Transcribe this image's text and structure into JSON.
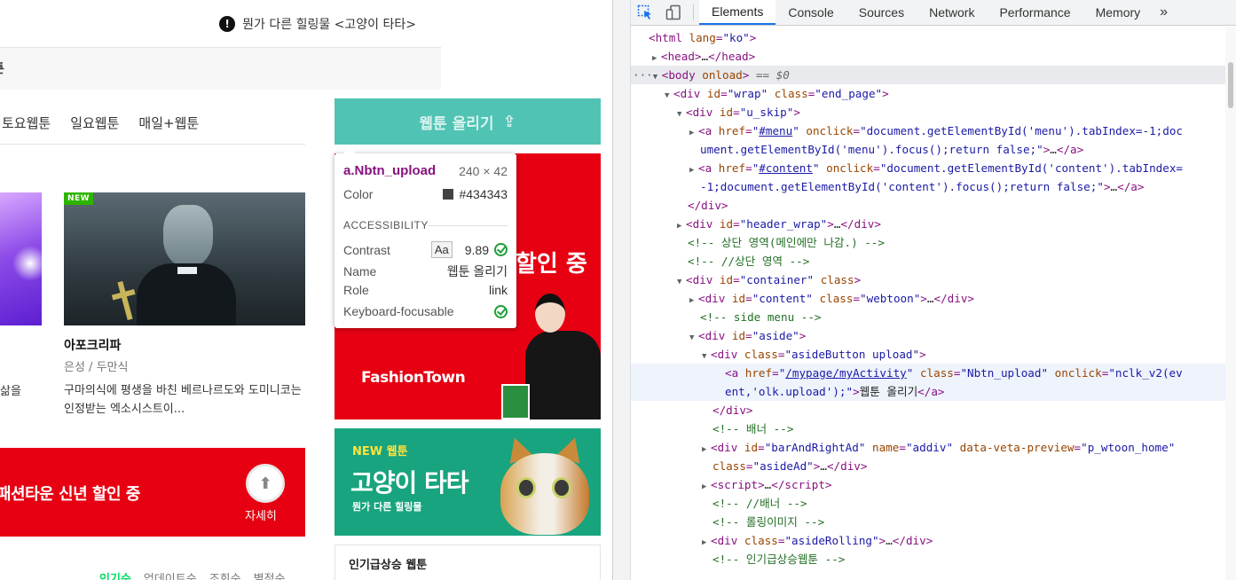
{
  "page": {
    "notice": "뭔가 다른 힐링물 <고양이 타타>",
    "notice_icon": "alert-icon",
    "crumb": "툰",
    "days": [
      "토요웹툰",
      "일요웹툰",
      "매일+웹툰"
    ],
    "featured": {
      "badge": "NEW",
      "title": "아포크리파",
      "author": "은성 / 두만식",
      "desc": "구마의식에 평생을 바친 베르나르도와 도미니코는 인정받는 엑소시스트이...",
      "left_desc": "삶을"
    },
    "banner_left": {
      "text": "패션타운 신년 할인 중",
      "more": "자세히"
    },
    "sort_tabs": [
      "인기순",
      "업데이트순",
      "조회순",
      "별점순"
    ],
    "aside": {
      "upload_label": "웹툰 올리기",
      "ad1_sale": "할인 중",
      "ad1_brand": "FashionTown",
      "ad2_new": "NEW 웹툰",
      "ad2_title": "고양이 타타",
      "ad2_sub": "뭔가 다른 힐링물",
      "rising": "인기급상승 웹툰"
    }
  },
  "tooltip": {
    "selector": "a.Nbtn_upload",
    "size": "240 × 42",
    "color_label": "Color",
    "color_value": "#434343",
    "section": "ACCESSIBILITY",
    "contrast_label": "Contrast",
    "contrast_value": "9.89",
    "name_label": "Name",
    "name_value": "웹툰 올리기",
    "role_label": "Role",
    "role_value": "link",
    "kbd_label": "Keyboard-focusable"
  },
  "devtools": {
    "tabs": [
      "Elements",
      "Console",
      "Sources",
      "Network",
      "Performance",
      "Memory"
    ],
    "active_tab": "Elements",
    "more": "»",
    "lines": [
      "<html lang=\"ko\">",
      "<head>…</head>",
      "<body onload> == $0",
      "<div id=\"wrap\" class=\"end_page\">",
      "<div id=\"u_skip\">"
    ]
  },
  "colors": {
    "accent": "#1a73e8",
    "upload": "#50c3b4",
    "red": "#e60012",
    "green_ad": "#18a47e"
  }
}
